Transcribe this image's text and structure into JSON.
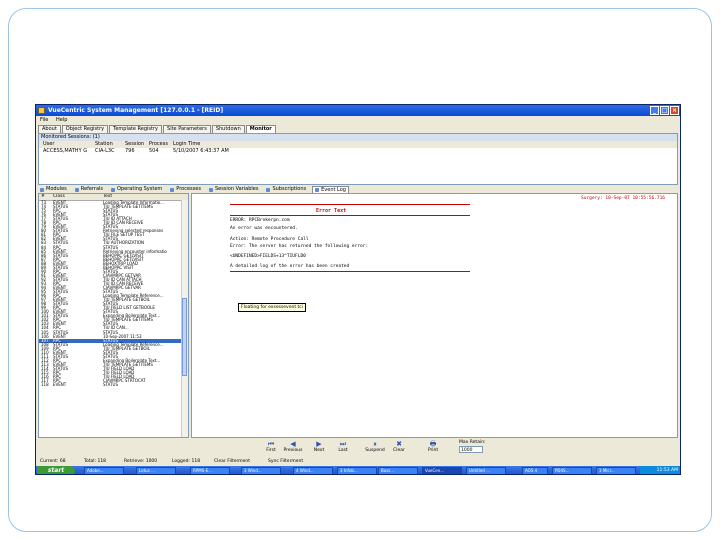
{
  "window": {
    "title": "VueCentric System Management [127.0.0.1 - [REID]",
    "controls": [
      "_",
      "□",
      "×"
    ]
  },
  "menu": [
    "File",
    "Help"
  ],
  "top_tabs": [
    {
      "label": "About",
      "active": false
    },
    {
      "label": "Object Registry",
      "active": false
    },
    {
      "label": "Template Registry",
      "active": false
    },
    {
      "label": "Site Parameters",
      "active": false
    },
    {
      "label": "Shutdown",
      "active": false
    },
    {
      "label": "Monitor",
      "active": true
    }
  ],
  "sessions": {
    "caption": "Monitored Sessions: (1)",
    "columns": [
      "User",
      "Station",
      "Session",
      "Process",
      "Login Time"
    ],
    "rows": [
      [
        "ACCESS,MATHY G",
        "CIA-L3C",
        "796",
        "504",
        "5/10/2007 6:43:37 AM"
      ]
    ]
  },
  "bottom_tabs": [
    {
      "label": "Modules",
      "active": false
    },
    {
      "label": "Referrals",
      "active": false
    },
    {
      "label": "Operating System",
      "active": false
    },
    {
      "label": "Processes",
      "active": false
    },
    {
      "label": "Session Variables",
      "active": false
    },
    {
      "label": "Subscriptions",
      "active": false
    },
    {
      "label": "Event Log",
      "active": true
    }
  ],
  "log": {
    "columns": [
      "#",
      "Class",
      "Text"
    ],
    "rows": [
      [
        "73",
        "EVENT",
        "Loading Template Informatio..."
      ],
      [
        "74",
        "STATUS",
        "TIU TEMPLATE GETITEMS"
      ],
      [
        "75",
        "RPC",
        "STATUS"
      ],
      [
        "76",
        "EVENT",
        "STATUS"
      ],
      [
        "77",
        "STATUS",
        "TIU ID ATTACH"
      ],
      [
        "78",
        "RPC",
        "TIU ID CAN RECEIVE"
      ],
      [
        "79",
        "EVENT",
        "STATUS"
      ],
      [
        "80",
        "STATUS",
        "Retrieving selected responses"
      ],
      [
        "81",
        "RPC",
        "TIU FILE SETUP TEST"
      ],
      [
        "82",
        "EVENT",
        "STATUS"
      ],
      [
        "83",
        "STATUS",
        "TIU AUTHORIZATION"
      ],
      [
        "84",
        "RPC",
        "STATUS"
      ],
      [
        "85",
        "EVENT",
        "Retrieving encounter informatio"
      ],
      [
        "86",
        "STATUS",
        "BEHOPRC GETLVISIT"
      ],
      [
        "87",
        "RPC",
        "BEHOPRC GETLVISIT"
      ],
      [
        "88",
        "EVENT",
        "BEHOXTRIP LOAD"
      ],
      [
        "89",
        "STATUS",
        "BEHOPRC VISIT"
      ],
      [
        "90",
        "RPC",
        "STATUS"
      ],
      [
        "91",
        "EVENT",
        "CIAVMRPC GETVAR"
      ],
      [
        "92",
        "STATUS",
        "TIU ID CAN ATTACH"
      ],
      [
        "93",
        "RPC",
        "TIU ID CAN RECEIVE"
      ],
      [
        "94",
        "EVENT",
        "CIAVMRPC GETVAR"
      ],
      [
        "95",
        "STATUS",
        "STATUS"
      ],
      [
        "96",
        "RPC",
        "Loading Template Reference..."
      ],
      [
        "97",
        "EVENT",
        "TIU TEMPLATE GETBOIL"
      ],
      [
        "98",
        "STATUS",
        "STATUS"
      ],
      [
        "99",
        "RPC",
        "TIU FIELD LIST GETBOOLE"
      ],
      [
        "100",
        "EVENT",
        "STATUS"
      ],
      [
        "101",
        "STATUS",
        "Expanding Boilerplate Text..."
      ],
      [
        "102",
        "RPC",
        "TIU TEMPLATE GETITEMS"
      ],
      [
        "103",
        "EVENT",
        "STATUS"
      ],
      [
        "104",
        "RPC",
        "TIU ID CAN..."
      ],
      [
        "105",
        "STATUS",
        "STATUS"
      ],
      [
        "106",
        "EVENT",
        "10-Sep-2007 11:53"
      ],
      [
        "107",
        "RPC",
        "STATUS"
      ],
      [
        "108",
        "STATUS",
        "Loading Template Reference..."
      ],
      [
        "109",
        "RPC",
        "TIU TEMPLATE GETBOIL"
      ],
      [
        "110",
        "EVENT",
        "STATUS"
      ],
      [
        "111",
        "STATUS",
        "STATUS"
      ],
      [
        "112",
        "RPC",
        "Expanding Boilerplate Text..."
      ],
      [
        "113",
        "EVENT",
        "TIU TEMPLATE GETITEMS"
      ],
      [
        "114",
        "STATUS",
        "TIU FIELD LOAD"
      ],
      [
        "115",
        "RPC",
        "TIU FIELD LOAD"
      ],
      [
        "116",
        "RPC",
        "TIU FIELD LOAD"
      ],
      [
        "117",
        "RPC",
        "CIAVMRPC STRTOCAT"
      ],
      [
        "118",
        "EVENT",
        "STATUS"
      ]
    ],
    "selected_index": 34
  },
  "detail": {
    "timestamp": "Surgery: 10-Sep-07 10:55:56.716",
    "title": "Error Text",
    "lines": [
      "ERROR: RPCBrokerpn.com",
      "An error was encountered.",
      "Action:  Remote Procedure Call",
      "Error:   The server has returned the following error:",
      "<UNDEFINED>FIELDS+13^TIUFLD0",
      "A detailed log of the error has been created"
    ],
    "tooltip": "Floating for exsessevent.tci"
  },
  "nav_buttons": [
    {
      "label": "First",
      "icon": "first-icon",
      "glyph": "⏮"
    },
    {
      "label": "Previous",
      "icon": "previous-icon",
      "glyph": "◀"
    },
    {
      "label": "Next",
      "icon": "next-icon",
      "glyph": "▶"
    },
    {
      "label": "Last",
      "icon": "last-icon",
      "glyph": "⏭"
    },
    {
      "label": "Suspend",
      "icon": "suspend-icon",
      "glyph": "⏸"
    },
    {
      "label": "Clear",
      "icon": "clear-icon",
      "glyph": "✖"
    },
    {
      "label": "Print",
      "icon": "print-icon",
      "glyph": "🖶"
    }
  ],
  "max_retain": {
    "label": "Max Retain:",
    "value": "1000"
  },
  "status_bar": [
    "Current: 68",
    "Total: 118",
    "Retrieve: 1000",
    "Logged: 118",
    "Clear Filterment",
    "Sync Filterment"
  ],
  "taskbar": {
    "start_label": "start",
    "buttons": [
      "Adobe...",
      "Lotus ...",
      "RPMS-E...",
      "3 Wind...",
      "4 Wind...",
      "3 Infob...",
      "Bass...",
      "VueCen...",
      "Untitled ...",
      "AOS 4",
      "PD4S...",
      "1 Micr..."
    ],
    "active_index": 7,
    "clock": "11:53 AM"
  },
  "colors": {
    "titlebar": "#0a4ad6",
    "selection": "#316ac5",
    "error_red": "#cc0000",
    "taskbar": "#245edb",
    "start_green": "#3c9a37"
  }
}
